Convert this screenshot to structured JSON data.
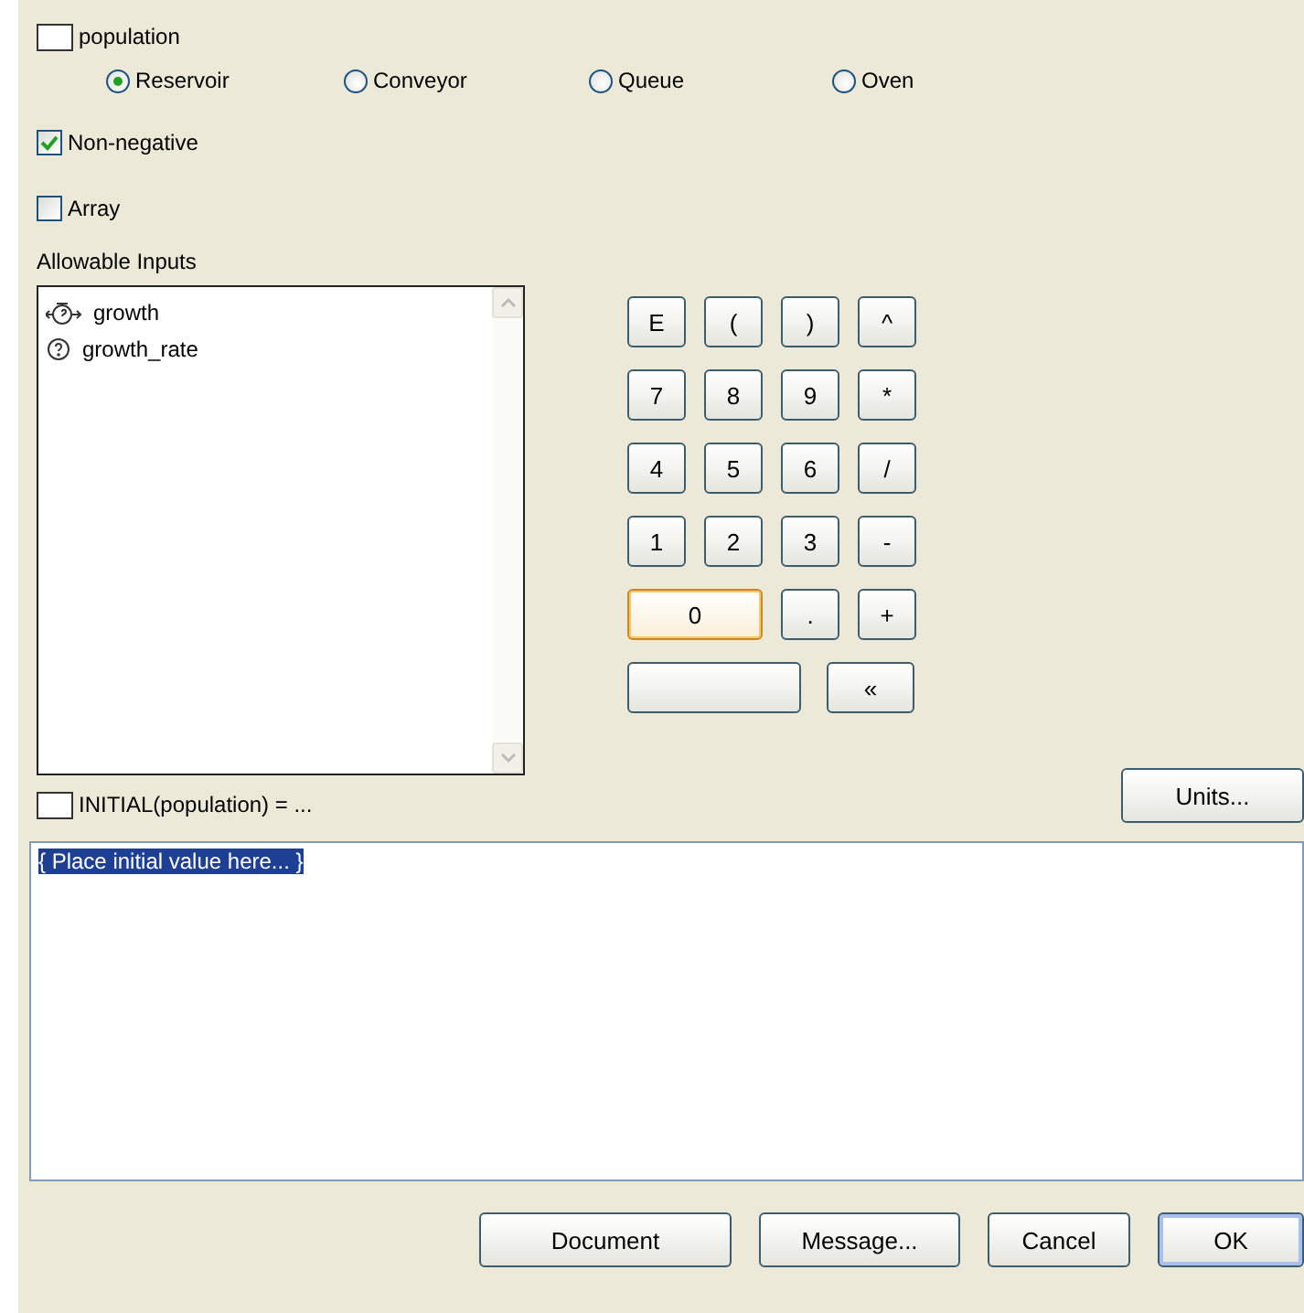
{
  "variable": {
    "label": "population",
    "checked": false
  },
  "types": [
    {
      "label": "Reservoir",
      "selected": true
    },
    {
      "label": "Conveyor",
      "selected": false
    },
    {
      "label": "Queue",
      "selected": false
    },
    {
      "label": "Oven",
      "selected": false
    }
  ],
  "options": [
    {
      "label": "Non-negative",
      "checked": true
    },
    {
      "label": "Array",
      "checked": false
    }
  ],
  "allowable_inputs": {
    "label": "Allowable Inputs",
    "items": [
      {
        "label": "growth",
        "kind": "flow"
      },
      {
        "label": "growth_rate",
        "kind": "converter"
      }
    ]
  },
  "keypad": [
    {
      "label": "E",
      "kind": "key",
      "focused": false
    },
    {
      "label": "(",
      "kind": "key",
      "focused": false
    },
    {
      "label": ")",
      "kind": "key",
      "focused": false
    },
    {
      "label": "^",
      "kind": "key",
      "focused": false
    },
    {
      "label": "7",
      "kind": "key",
      "focused": false
    },
    {
      "label": "8",
      "kind": "key",
      "focused": false
    },
    {
      "label": "9",
      "kind": "key",
      "focused": false
    },
    {
      "label": "*",
      "kind": "key",
      "focused": false
    },
    {
      "label": "4",
      "kind": "key",
      "focused": false
    },
    {
      "label": "5",
      "kind": "key",
      "focused": false
    },
    {
      "label": "6",
      "kind": "key",
      "focused": false
    },
    {
      "label": "/",
      "kind": "key",
      "focused": false
    },
    {
      "label": "1",
      "kind": "key",
      "focused": false
    },
    {
      "label": "2",
      "kind": "key",
      "focused": false
    },
    {
      "label": "3",
      "kind": "key",
      "focused": false
    },
    {
      "label": "-",
      "kind": "key",
      "focused": false
    },
    {
      "label": "0",
      "kind": "wide",
      "focused": true
    },
    {
      "label": ".",
      "kind": "key",
      "focused": false
    },
    {
      "label": "+",
      "kind": "key",
      "focused": false
    },
    {
      "kind": "blank",
      "focused": false
    },
    {
      "label": "«",
      "kind": "backspace",
      "focused": false
    }
  ],
  "initial": {
    "label": "INITIAL(population) = ...",
    "checked": false
  },
  "units_button": "Units...",
  "equation": {
    "value": "{ Place initial value here... }",
    "selected": true
  },
  "buttons": [
    {
      "label": "Document",
      "default": false
    },
    {
      "label": "Message...",
      "default": false
    },
    {
      "label": "Cancel",
      "default": false
    },
    {
      "label": "OK",
      "default": true
    }
  ]
}
